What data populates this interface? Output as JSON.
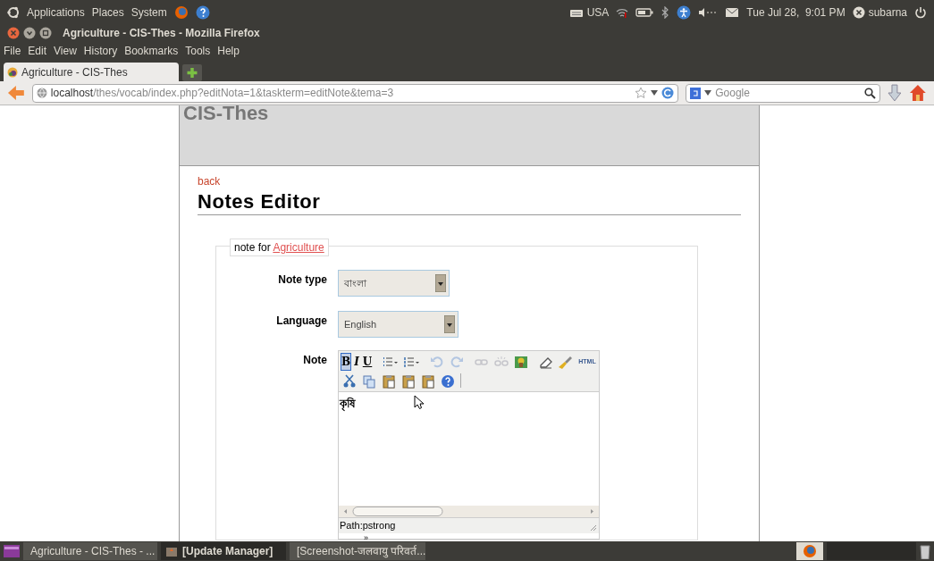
{
  "top_panel": {
    "menus": [
      "Applications",
      "Places",
      "System"
    ],
    "keyboard": "USA",
    "clock": "Tue Jul 28,  9:01 PM",
    "user": "subarna"
  },
  "window": {
    "title": "Agriculture - CIS-Thes - Mozilla Firefox"
  },
  "menu": [
    "File",
    "Edit",
    "View",
    "History",
    "Bookmarks",
    "Tools",
    "Help"
  ],
  "tabs": [
    {
      "label": "Agriculture - CIS-Thes",
      "selected": true
    }
  ],
  "address": {
    "host": "localhost",
    "path": "/thes/vocab/index.php?editNota=1&taskterm=editNote&tema=3"
  },
  "search": {
    "placeholder": "Google"
  },
  "page": {
    "site_title": "CIS-Thes",
    "back": "back",
    "heading": "Notes Editor",
    "legend": "note for ",
    "legend_link": "Agriculture",
    "fields": [
      {
        "label": "Note type",
        "value": "বাংলা"
      },
      {
        "label": "Language",
        "value": "English"
      }
    ],
    "editor": {
      "label": "Note",
      "toolbar_rows": [
        [
          {
            "kind": "text",
            "label": "B",
            "selected": true,
            "disabled": false
          },
          {
            "kind": "text",
            "label": "I",
            "selected": false,
            "disabled": false
          },
          {
            "kind": "text",
            "label": "U",
            "selected": false,
            "disabled": false
          },
          {
            "kind": "sep"
          },
          {
            "kind": "bullets",
            "selected": false,
            "disabled": false
          },
          {
            "kind": "numbers",
            "selected": false,
            "disabled": false
          },
          {
            "kind": "sep"
          },
          {
            "kind": "undo",
            "selected": false,
            "disabled": true
          },
          {
            "kind": "redo",
            "selected": false,
            "disabled": true
          },
          {
            "kind": "sep"
          },
          {
            "kind": "link",
            "selected": false,
            "disabled": true
          },
          {
            "kind": "unlink",
            "selected": false,
            "disabled": true
          },
          {
            "kind": "image",
            "selected": false,
            "disabled": false
          },
          {
            "kind": "sep"
          },
          {
            "kind": "eraser",
            "selected": false,
            "disabled": false
          },
          {
            "kind": "brush",
            "selected": false,
            "disabled": false
          },
          {
            "kind": "text",
            "label": "HTML",
            "selected": false,
            "disabled": false
          }
        ],
        [
          {
            "kind": "cut",
            "selected": false,
            "disabled": false
          },
          {
            "kind": "copy",
            "selected": false,
            "disabled": false
          },
          {
            "kind": "paste",
            "selected": false,
            "disabled": false
          },
          {
            "kind": "paste",
            "selected": false,
            "disabled": false
          },
          {
            "kind": "paste",
            "selected": false,
            "disabled": false
          },
          {
            "kind": "help",
            "selected": false,
            "disabled": false
          },
          {
            "kind": "sep"
          }
        ]
      ],
      "content": "কৃষি",
      "path": "Path:pstrong",
      "below": "»"
    }
  },
  "taskbar": [
    {
      "kind": "browser",
      "label": "Agriculture - CIS-Thes - ...",
      "selected": false
    },
    {
      "kind": "package",
      "label": "[Update Manager]",
      "selected": true
    },
    {
      "kind": "screen",
      "label": "[Screenshot-जलवायु परिवर्त...",
      "selected": false
    }
  ]
}
